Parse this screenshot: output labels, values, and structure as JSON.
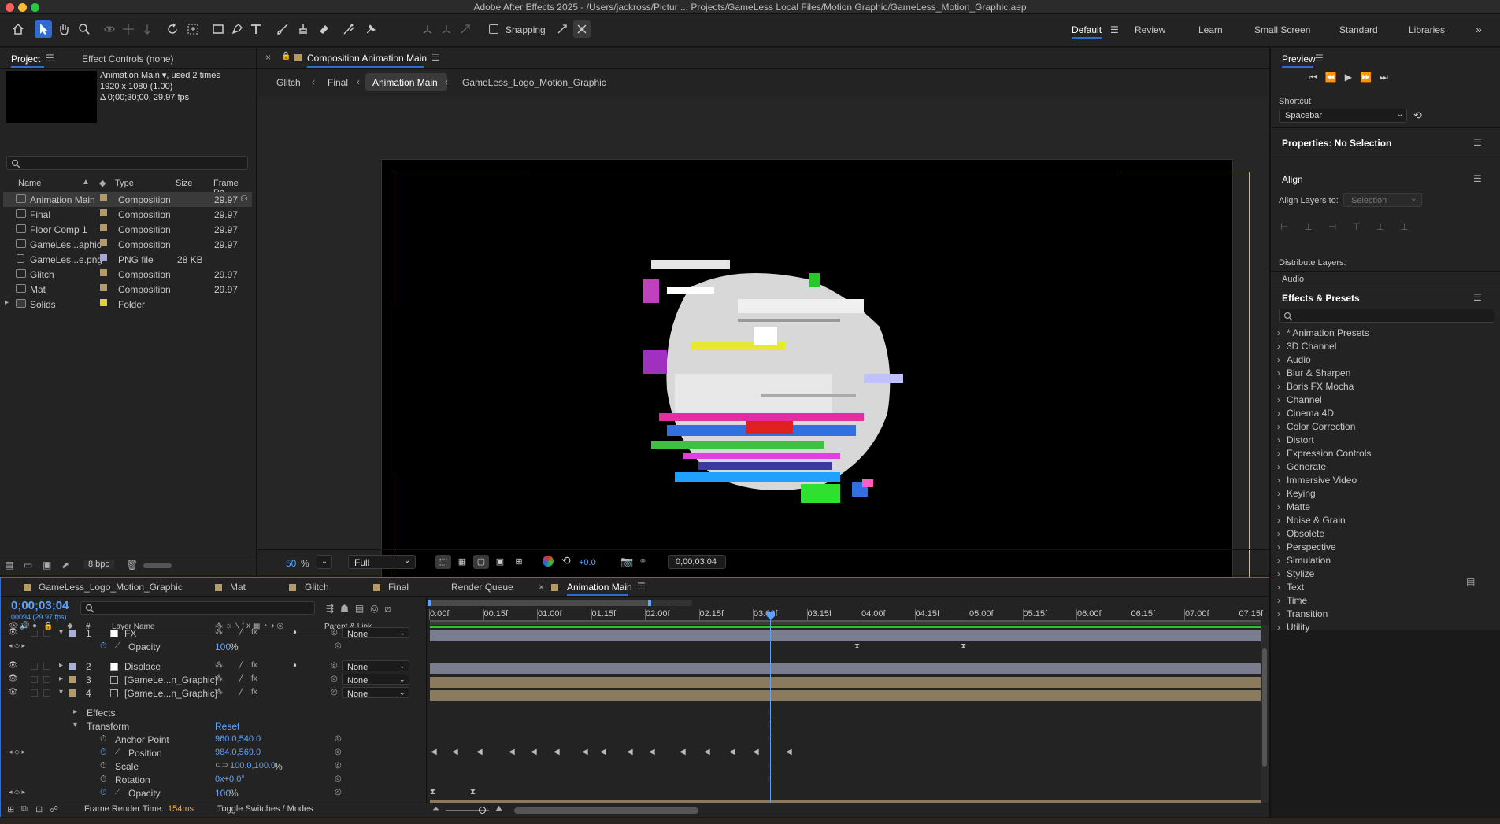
{
  "app": {
    "window_title": "Adobe After Effects 2025 - /Users/jackross/Pictur ...  Projects/GameLess Local Files/Motion Graphic/GameLess_Motion_Graphic.aep"
  },
  "toolbar": {
    "snapping_label": "Snapping",
    "workspaces": [
      "Default",
      "Review",
      "Learn",
      "Small Screen",
      "Standard",
      "Libraries"
    ],
    "active_workspace": "Default"
  },
  "project_panel": {
    "tab_project": "Project",
    "tab_effect_controls": "Effect Controls (none)",
    "selected_name": "Animation Main",
    "used_text": ", used 2 times",
    "resolution": "1920 x 1080 (1.00)",
    "duration": "Δ 0;00;30;00, 29.97 fps",
    "columns": {
      "name": "Name",
      "type": "Type",
      "size": "Size",
      "frame_rate": "Frame Ra..."
    },
    "items": [
      {
        "name": "Animation Main",
        "type": "Composition",
        "size": "",
        "fps": "29.97",
        "color": "#b49a64",
        "icon": "composition-icon"
      },
      {
        "name": "Final",
        "type": "Composition",
        "size": "",
        "fps": "29.97",
        "color": "#b49a64",
        "icon": "composition-icon"
      },
      {
        "name": "Floor Comp 1",
        "type": "Composition",
        "size": "",
        "fps": "29.97",
        "color": "#b49a64",
        "icon": "composition-icon"
      },
      {
        "name": "GameLes...aphic",
        "type": "Composition",
        "size": "",
        "fps": "29.97",
        "color": "#b49a64",
        "icon": "composition-icon"
      },
      {
        "name": "GameLes...e.png",
        "type": "PNG file",
        "size": "28 KB",
        "fps": "",
        "color": "#a6a6d8",
        "icon": "file-icon"
      },
      {
        "name": "Glitch",
        "type": "Composition",
        "size": "",
        "fps": "29.97",
        "color": "#b49a64",
        "icon": "composition-icon"
      },
      {
        "name": "Mat",
        "type": "Composition",
        "size": "",
        "fps": "29.97",
        "color": "#b49a64",
        "icon": "composition-icon"
      },
      {
        "name": "Solids",
        "type": "Folder",
        "size": "",
        "fps": "",
        "color": "#e0d23c",
        "icon": "folder-icon"
      }
    ],
    "bpc": "8 bpc"
  },
  "comp_panel": {
    "title": "Composition Animation Main",
    "breadcrumbs": [
      "Glitch",
      "Final",
      "Animation Main",
      "GameLess_Logo_Motion_Graphic"
    ],
    "zoom": "50",
    "zoom_unit": "%",
    "resolution": "Full",
    "exposure": "+0.0",
    "timecode": "0;00;03;04"
  },
  "right_panel": {
    "preview_title": "Preview",
    "shortcut_label": "Shortcut",
    "shortcut_value": "Spacebar",
    "properties_title": "Properties: No Selection",
    "align_title": "Align",
    "align_layers_to": "Align Layers to:",
    "align_selection": "Selection",
    "distribute_layers": "Distribute Layers:",
    "audio": "Audio",
    "effects_title": "Effects & Presets",
    "effects": [
      "* Animation Presets",
      "3D Channel",
      "Audio",
      "Blur & Sharpen",
      "Boris FX Mocha",
      "Channel",
      "Cinema 4D",
      "Color Correction",
      "Distort",
      "Expression Controls",
      "Generate",
      "Immersive Video",
      "Keying",
      "Matte",
      "Noise & Grain",
      "Obsolete",
      "Perspective",
      "Simulation",
      "Stylize",
      "Text",
      "Time",
      "Transition",
      "Utility"
    ]
  },
  "timeline": {
    "tabs": [
      "GameLess_Logo_Motion_Graphic",
      "Mat",
      "Glitch",
      "Final",
      "Render Queue",
      "Animation Main"
    ],
    "active_tab": "Animation Main",
    "current_time": "0;00;03;04",
    "frame_info": "00094 (29.97 fps)",
    "col_layer_name": "Layer Name",
    "col_hash": "#",
    "col_parent": "Parent & Link",
    "ruler": [
      "0:00f",
      "00:15f",
      "01:00f",
      "01:15f",
      "02:00f",
      "02:15f",
      "03:00f",
      "03:15f",
      "04:00f",
      "04:15f",
      "05:00f",
      "05:15f",
      "06:00f",
      "06:15f",
      "07:00f",
      "07:15f"
    ],
    "layers": [
      {
        "num": "1",
        "name": "FX",
        "parent": "None",
        "color": "#a9b0d8"
      },
      {
        "num": "2",
        "name": "Displace",
        "parent": "None",
        "color": "#a9b0d8"
      },
      {
        "num": "3",
        "name": "[GameLe...n_Graphic]",
        "parent": "None",
        "color": "#b49a64"
      },
      {
        "num": "4",
        "name": "[GameLe...n_Graphic]",
        "parent": "None",
        "color": "#b49a64"
      }
    ],
    "opacity_label": "Opacity",
    "opacity_value": "100",
    "opacity_unit": "%",
    "effects_label": "Effects",
    "transform_label": "Transform",
    "reset_label": "Reset",
    "anchor_label": "Anchor Point",
    "anchor_value": "960.0,540.0",
    "position_label": "Position",
    "position_value": "984.0,569.0",
    "scale_label": "Scale",
    "scale_value": "100.0,100.0",
    "scale_unit": "%",
    "rotation_label": "Rotation",
    "rotation_value": "0x+0.0°",
    "opacity2_value": "100",
    "frame_render_label": "Frame Render Time:",
    "frame_render_value": "154ms",
    "toggle_label": "Toggle Switches / Modes"
  }
}
